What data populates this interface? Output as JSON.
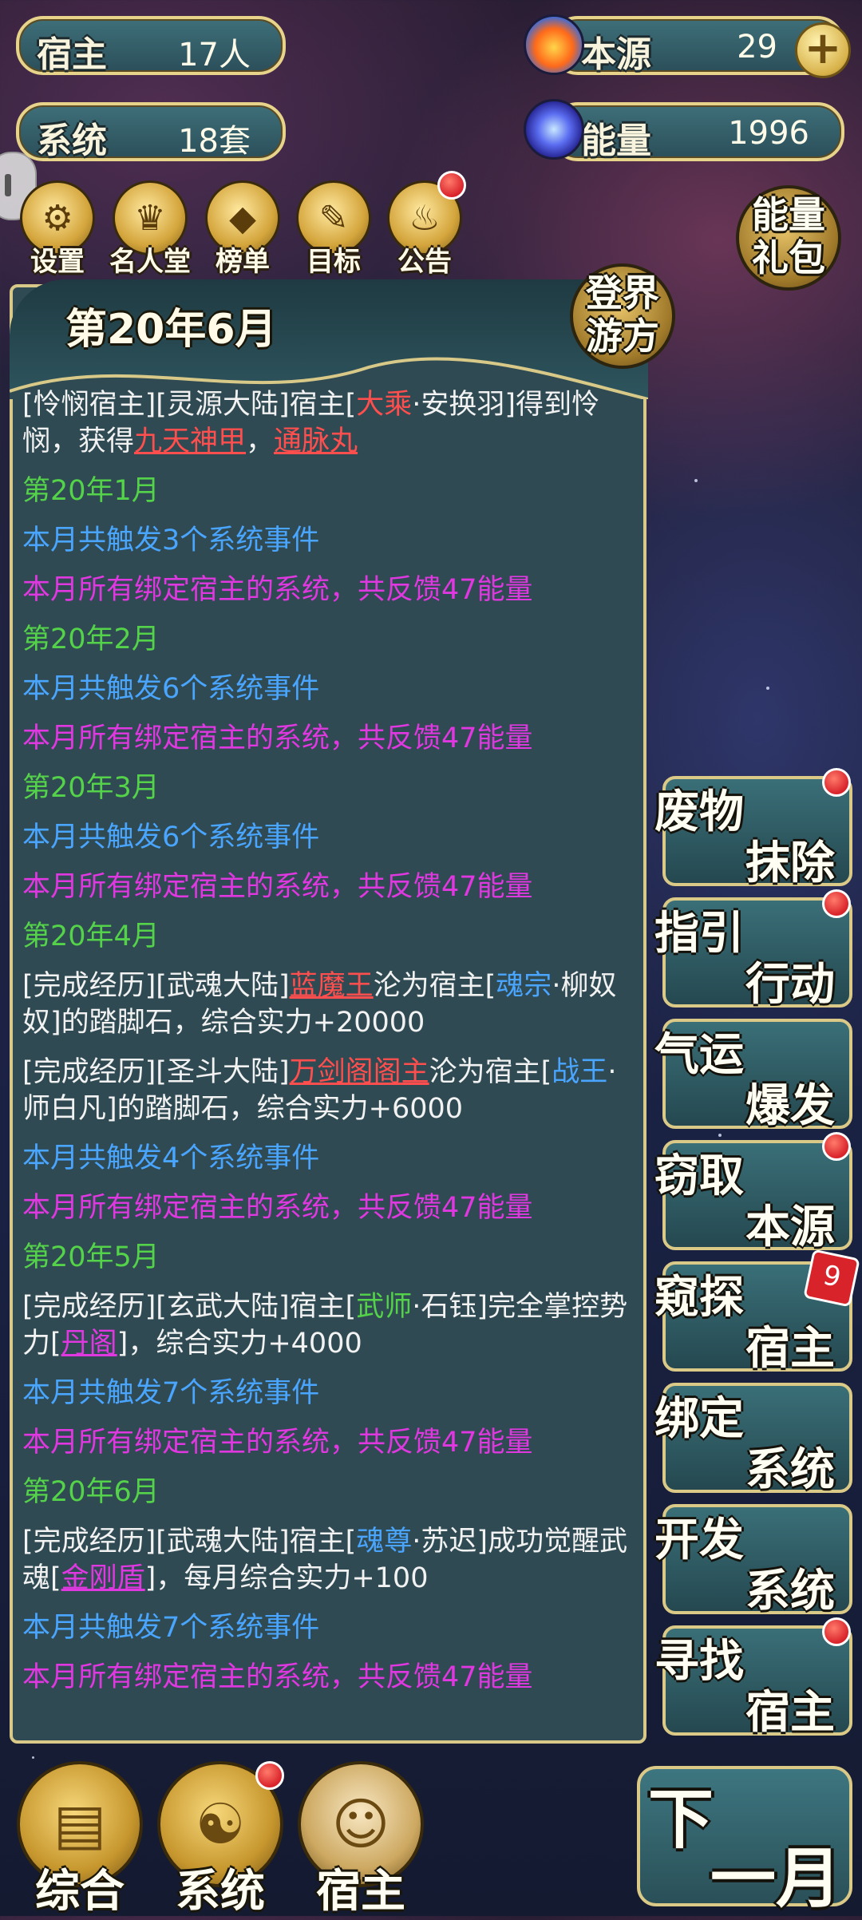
{
  "top_stats": {
    "host": {
      "label": "宿主",
      "value": "17人"
    },
    "system": {
      "label": "系统",
      "value": "18套"
    },
    "origin": {
      "label": "本源",
      "value": "29",
      "icon": "flame-orb-icon"
    },
    "energy": {
      "label": "能量",
      "value": "1996",
      "icon": "vortex-orb-icon"
    }
  },
  "menu": [
    {
      "label": "设置",
      "icon": "gear-icon"
    },
    {
      "label": "名人堂",
      "icon": "crown-icon"
    },
    {
      "label": "榜单",
      "icon": "crystal-icon"
    },
    {
      "label": "目标",
      "icon": "scroll-icon"
    },
    {
      "label": "公告",
      "icon": "bell-icon"
    }
  ],
  "energy_pack": "能量礼包",
  "travel_button": "登界游方",
  "panel": {
    "date_title": "第20年6月"
  },
  "log": [
    {
      "type": "event",
      "parts": [
        {
          "t": "[怜悯宿主][灵源大陆]宿主[",
          "c": "white"
        },
        {
          "t": "大乘",
          "c": "red"
        },
        {
          "t": "·安换羽]得到怜悯，获得",
          "c": "white"
        },
        {
          "t": "九天神甲",
          "c": "red",
          "u": true
        },
        {
          "t": "，",
          "c": "white"
        },
        {
          "t": "通脉丸",
          "c": "red",
          "u": true
        }
      ]
    },
    {
      "type": "month",
      "text": "第20年1月"
    },
    {
      "type": "trigger",
      "text": "本月共触发3个系统事件"
    },
    {
      "type": "feedback",
      "text": "本月所有绑定宿主的系统，共反馈47能量"
    },
    {
      "type": "month",
      "text": "第20年2月"
    },
    {
      "type": "trigger",
      "text": "本月共触发6个系统事件"
    },
    {
      "type": "feedback",
      "text": "本月所有绑定宿主的系统，共反馈47能量"
    },
    {
      "type": "month",
      "text": "第20年3月"
    },
    {
      "type": "trigger",
      "text": "本月共触发6个系统事件"
    },
    {
      "type": "feedback",
      "text": "本月所有绑定宿主的系统，共反馈47能量"
    },
    {
      "type": "month",
      "text": "第20年4月"
    },
    {
      "type": "event",
      "parts": [
        {
          "t": "[完成经历][武魂大陆]",
          "c": "white"
        },
        {
          "t": "蓝魔王",
          "c": "red",
          "u": true
        },
        {
          "t": "沦为宿主[",
          "c": "white"
        },
        {
          "t": "魂宗",
          "c": "blue"
        },
        {
          "t": "·柳奴奴]的踏脚石，综合实力+20000",
          "c": "white"
        }
      ]
    },
    {
      "type": "event",
      "parts": [
        {
          "t": "[完成经历][圣斗大陆]",
          "c": "white"
        },
        {
          "t": "万剑阁阁主",
          "c": "red",
          "u": true
        },
        {
          "t": "沦为宿主[",
          "c": "white"
        },
        {
          "t": "战王",
          "c": "blue"
        },
        {
          "t": "·师白凡]的踏脚石，综合实力+6000",
          "c": "white"
        }
      ]
    },
    {
      "type": "trigger",
      "text": "本月共触发4个系统事件"
    },
    {
      "type": "feedback",
      "text": "本月所有绑定宿主的系统，共反馈47能量"
    },
    {
      "type": "month",
      "text": "第20年5月"
    },
    {
      "type": "event",
      "parts": [
        {
          "t": "[完成经历][玄武大陆]宿主[",
          "c": "white"
        },
        {
          "t": "武师",
          "c": "green"
        },
        {
          "t": "·石钰]完全掌控势力[",
          "c": "white"
        },
        {
          "t": "丹阁",
          "c": "magenta",
          "u": true
        },
        {
          "t": "]，综合实力+4000",
          "c": "white"
        }
      ]
    },
    {
      "type": "trigger",
      "text": "本月共触发7个系统事件"
    },
    {
      "type": "feedback",
      "text": "本月所有绑定宿主的系统，共反馈47能量"
    },
    {
      "type": "month",
      "text": "第20年6月"
    },
    {
      "type": "event",
      "parts": [
        {
          "t": "[完成经历][武魂大陆]宿主[",
          "c": "white"
        },
        {
          "t": "魂尊",
          "c": "blue"
        },
        {
          "t": "·苏迟]成功觉醒武魂[",
          "c": "white"
        },
        {
          "t": "金刚盾",
          "c": "magenta",
          "u": true
        },
        {
          "t": "]，每月综合实力+100",
          "c": "white"
        }
      ]
    },
    {
      "type": "trigger",
      "text": "本月共触发7个系统事件"
    },
    {
      "type": "feedback",
      "text": "本月所有绑定宿主的系统，共反馈47能量"
    }
  ],
  "actions": [
    {
      "t1": "废物",
      "t2": "抹除",
      "dot": true
    },
    {
      "t1": "指引",
      "t2": "行动",
      "dot": true
    },
    {
      "t1": "气运",
      "t2": "爆发",
      "dot": false
    },
    {
      "t1": "窃取",
      "t2": "本源",
      "dot": true
    },
    {
      "t1": "窥探",
      "t2": "宿主",
      "badge": "9"
    },
    {
      "t1": "绑定",
      "t2": "系统",
      "dot": false
    },
    {
      "t1": "开发",
      "t2": "系统",
      "dot": false
    },
    {
      "t1": "寻找",
      "t2": "宿主",
      "dot": true
    }
  ],
  "bottom_tabs": [
    {
      "label": "综合",
      "icon": "book-icon"
    },
    {
      "label": "系统",
      "icon": "yin-yang-icon"
    },
    {
      "label": "宿主",
      "icon": "character-portrait-icon"
    }
  ],
  "next_month": {
    "n1": "下",
    "n2": "一月"
  },
  "colors": {
    "month": "#54d34a",
    "trigger": "#4aa5ff",
    "feedback": "#e038e0",
    "highlight": "#ff4e4e",
    "panel_bg": "#2f4a52",
    "gold": "#dac987"
  }
}
